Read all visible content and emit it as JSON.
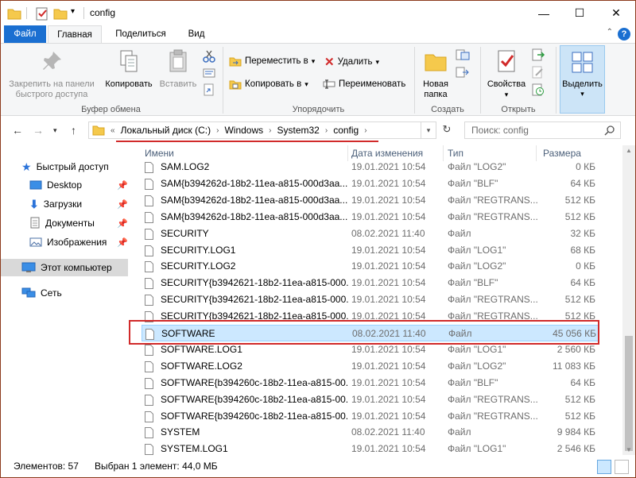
{
  "window": {
    "title": "config"
  },
  "tabs": {
    "file": "Файл",
    "home": "Главная",
    "share": "Поделиться",
    "view": "Вид"
  },
  "ribbon": {
    "clipboard": {
      "group_label": "Буфер обмена",
      "pin": "Закрепить на панели быстрого доступа",
      "copy": "Копировать",
      "paste": "Вставить"
    },
    "organize": {
      "group_label": "Упорядочить",
      "move": "Переместить в",
      "copy_to": "Копировать в",
      "delete": "Удалить",
      "rename": "Переименовать"
    },
    "create": {
      "group_label": "Создать",
      "new_folder": "Новая папка"
    },
    "open": {
      "group_label": "Открыть",
      "properties": "Свойства"
    },
    "select": {
      "label": "Выделить"
    }
  },
  "address": {
    "overflow": "«",
    "crumbs": [
      "Локальный диск (C:)",
      "Windows",
      "System32",
      "config"
    ]
  },
  "search": {
    "placeholder": "Поиск: config"
  },
  "navpane": {
    "quick_access": "Быстрый доступ",
    "desktop": "Desktop",
    "downloads": "Загрузки",
    "documents": "Документы",
    "pictures": "Изображения",
    "this_pc": "Этот компьютер",
    "network": "Сеть"
  },
  "columns": {
    "name": "Имени",
    "date": "Дата изменения",
    "type": "Тип",
    "size": "Размера"
  },
  "files": [
    {
      "name": "SAM.LOG2",
      "date": "19.01.2021 10:54",
      "type": "Файл \"LOG2\"",
      "size": "0 КБ"
    },
    {
      "name": "SAM{b394262d-18b2-11ea-a815-000d3aa...",
      "date": "19.01.2021 10:54",
      "type": "Файл \"BLF\"",
      "size": "64 КБ"
    },
    {
      "name": "SAM{b394262d-18b2-11ea-a815-000d3aa...",
      "date": "19.01.2021 10:54",
      "type": "Файл \"REGTRANS...",
      "size": "512 КБ"
    },
    {
      "name": "SAM{b394262d-18b2-11ea-a815-000d3aa...",
      "date": "19.01.2021 10:54",
      "type": "Файл \"REGTRANS...",
      "size": "512 КБ"
    },
    {
      "name": "SECURITY",
      "date": "08.02.2021 11:40",
      "type": "Файл",
      "size": "32 КБ"
    },
    {
      "name": "SECURITY.LOG1",
      "date": "19.01.2021 10:54",
      "type": "Файл \"LOG1\"",
      "size": "68 КБ"
    },
    {
      "name": "SECURITY.LOG2",
      "date": "19.01.2021 10:54",
      "type": "Файл \"LOG2\"",
      "size": "0 КБ"
    },
    {
      "name": "SECURITY{b3942621-18b2-11ea-a815-000...",
      "date": "19.01.2021 10:54",
      "type": "Файл \"BLF\"",
      "size": "64 КБ"
    },
    {
      "name": "SECURITY{b3942621-18b2-11ea-a815-000...",
      "date": "19.01.2021 10:54",
      "type": "Файл \"REGTRANS...",
      "size": "512 КБ"
    },
    {
      "name": "SECURITY{b3942621-18b2-11ea-a815-000...",
      "date": "19.01.2021 10:54",
      "type": "Файл \"REGTRANS...",
      "size": "512 КБ"
    },
    {
      "name": "SOFTWARE",
      "date": "08.02.2021 11:40",
      "type": "Файл",
      "size": "45 056 КБ"
    },
    {
      "name": "SOFTWARE.LOG1",
      "date": "19.01.2021 10:54",
      "type": "Файл \"LOG1\"",
      "size": "2 560 КБ"
    },
    {
      "name": "SOFTWARE.LOG2",
      "date": "19.01.2021 10:54",
      "type": "Файл \"LOG2\"",
      "size": "11 083 КБ"
    },
    {
      "name": "SOFTWARE{b394260c-18b2-11ea-a815-00...",
      "date": "19.01.2021 10:54",
      "type": "Файл \"BLF\"",
      "size": "64 КБ"
    },
    {
      "name": "SOFTWARE{b394260c-18b2-11ea-a815-00...",
      "date": "19.01.2021 10:54",
      "type": "Файл \"REGTRANS...",
      "size": "512 КБ"
    },
    {
      "name": "SOFTWARE{b394260c-18b2-11ea-a815-00...",
      "date": "19.01.2021 10:54",
      "type": "Файл \"REGTRANS...",
      "size": "512 КБ"
    },
    {
      "name": "SYSTEM",
      "date": "08.02.2021 11:40",
      "type": "Файл",
      "size": "9 984 КБ"
    },
    {
      "name": "SYSTEM.LOG1",
      "date": "19.01.2021 10:54",
      "type": "Файл \"LOG1\"",
      "size": "2 546 КБ"
    }
  ],
  "selected_index": 10,
  "status": {
    "count": "Элементов: 57",
    "selection": "Выбран 1 элемент: 44,0 МБ"
  },
  "colors": {
    "accent": "#1a6fd1",
    "selection_bg": "#cce8ff",
    "annotation": "#d12a2a"
  }
}
